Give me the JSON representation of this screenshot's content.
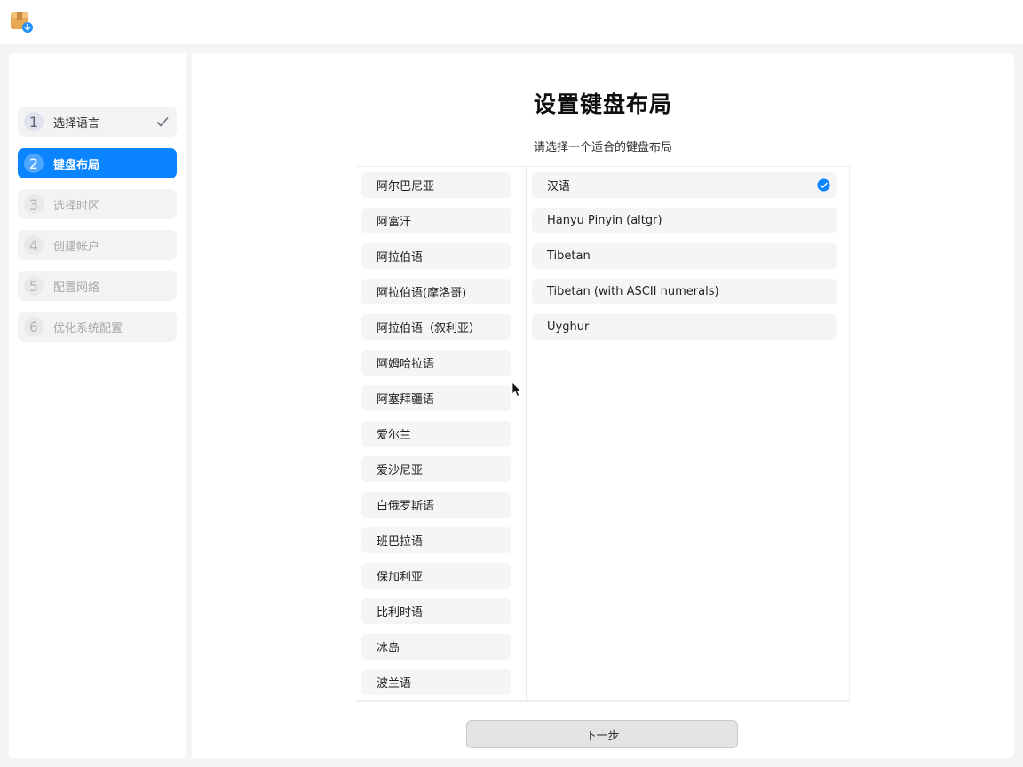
{
  "app": {
    "icon": "installer-package-icon"
  },
  "sidebar": {
    "steps": [
      {
        "num": "1",
        "label": "选择语言",
        "state": "done"
      },
      {
        "num": "2",
        "label": "键盘布局",
        "state": "active"
      },
      {
        "num": "3",
        "label": "选择时区",
        "state": "todo"
      },
      {
        "num": "4",
        "label": "创建帐户",
        "state": "todo"
      },
      {
        "num": "5",
        "label": "配置网络",
        "state": "todo"
      },
      {
        "num": "6",
        "label": "优化系统配置",
        "state": "todo"
      }
    ]
  },
  "main": {
    "title": "设置键盘布局",
    "subtitle": "请选择一个适合的键盘布局",
    "languages": [
      "阿尔巴尼亚",
      "阿富汗",
      "阿拉伯语",
      "阿拉伯语(摩洛哥)",
      "阿拉伯语（叙利亚）",
      "阿姆哈拉语",
      "阿塞拜疆语",
      "爱尔兰",
      "爱沙尼亚",
      "白俄罗斯语",
      "班巴拉语",
      "保加利亚",
      "比利时语",
      "冰岛",
      "波兰语"
    ],
    "layouts": [
      {
        "label": "汉语",
        "selected": true
      },
      {
        "label": "Hanyu Pinyin (altgr)",
        "selected": false
      },
      {
        "label": "Tibetan",
        "selected": false
      },
      {
        "label": "Tibetan (with ASCII numerals)",
        "selected": false
      },
      {
        "label": "Uyghur",
        "selected": false
      }
    ],
    "next_label": "下一步"
  },
  "colors": {
    "accent": "#0a84ff",
    "surface": "#ffffff",
    "background": "#f5f5f7"
  }
}
